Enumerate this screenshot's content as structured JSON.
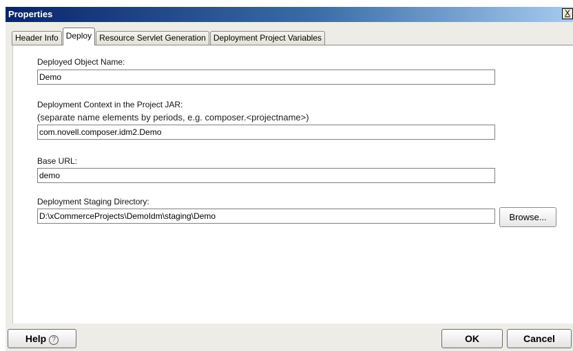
{
  "window": {
    "title": "Properties",
    "close_glyph": "X"
  },
  "tabs": [
    {
      "label": "Header Info",
      "active": false
    },
    {
      "label": "Deploy",
      "active": true
    },
    {
      "label": "Resource Servlet Generation",
      "active": false
    },
    {
      "label": "Deployment Project Variables",
      "active": false
    }
  ],
  "form": {
    "object_name": {
      "label": "Deployed Object Name:",
      "value": "Demo"
    },
    "context": {
      "label": "Deployment Context in the Project JAR:",
      "hint": "(separate name elements by periods, e.g. composer.<projectname>)",
      "value": "com.novell.composer.idm2.Demo"
    },
    "base_url": {
      "label": "Base URL:",
      "value": "demo"
    },
    "staging": {
      "label": "Deployment Staging Directory:",
      "value": "D:\\xCommerceProjects\\DemoIdm\\staging\\Demo",
      "browse_label": "Browse..."
    }
  },
  "footer": {
    "help_label": "Help",
    "help_icon": "?",
    "ok_label": "OK",
    "cancel_label": "Cancel"
  }
}
